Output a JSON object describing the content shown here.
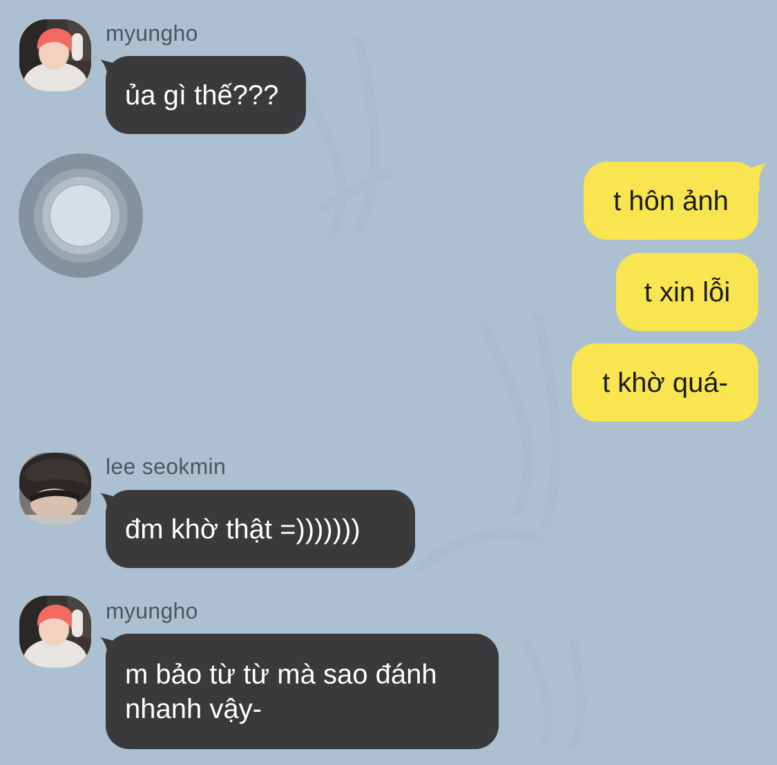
{
  "colors": {
    "background": "#adc0d1",
    "incoming_bubble": "#3a3a3c",
    "outgoing_bubble": "#f8e54f",
    "sender_name": "#4a5663"
  },
  "messages": [
    {
      "sender": "myungho",
      "direction": "incoming",
      "avatar": "myungho-avatar",
      "text": "ủa gì thế???"
    },
    {
      "direction": "outgoing",
      "text": "t hôn ảnh"
    },
    {
      "direction": "outgoing",
      "text": "t xin lỗi"
    },
    {
      "direction": "outgoing",
      "text": "t khờ quá-"
    },
    {
      "sender": "lee seokmin",
      "direction": "incoming",
      "avatar": "seokmin-avatar",
      "text": "đm khờ thật =)))))))"
    },
    {
      "sender": "myungho",
      "direction": "incoming",
      "avatar": "myungho-avatar",
      "text_line1": "m bảo từ từ mà sao đánh",
      "text_line2": "nhanh vậy-"
    }
  ],
  "overlay": {
    "icon": "assistive-touch-icon"
  }
}
